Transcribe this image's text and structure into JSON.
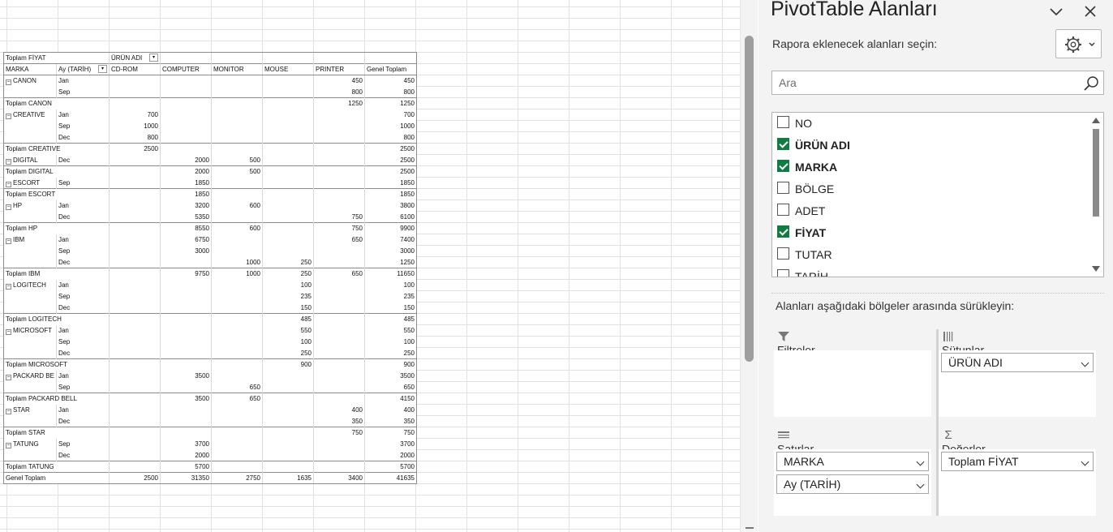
{
  "pivot": {
    "filter_label": "Toplam FİYAT",
    "col_field": "ÜRÜN ADI",
    "headers": [
      "MARKA",
      "Ay (TARİH)",
      "CD-ROM",
      "COMPUTER",
      "MONITOR",
      "MOUSE",
      "PRINTER",
      "Genel Toplam"
    ],
    "rows": [
      {
        "kind": "item",
        "brand": "CANON",
        "month": "Jan",
        "v": [
          "",
          "",
          "",
          "",
          "450",
          "450"
        ]
      },
      {
        "kind": "item",
        "brand": "",
        "month": "Sep",
        "v": [
          "",
          "",
          "",
          "",
          "800",
          "800"
        ]
      },
      {
        "kind": "total",
        "label": "Toplam CANON",
        "v": [
          "",
          "",
          "",
          "",
          "1250",
          "1250"
        ]
      },
      {
        "kind": "item",
        "brand": "CREATIVE",
        "month": "Jan",
        "v": [
          "700",
          "",
          "",
          "",
          "",
          "700"
        ]
      },
      {
        "kind": "item",
        "brand": "",
        "month": "Sep",
        "v": [
          "1000",
          "",
          "",
          "",
          "",
          "1000"
        ]
      },
      {
        "kind": "item",
        "brand": "",
        "month": "Dec",
        "v": [
          "800",
          "",
          "",
          "",
          "",
          "800"
        ]
      },
      {
        "kind": "total",
        "label": "Toplam CREATIVE",
        "v": [
          "2500",
          "",
          "",
          "",
          "",
          "2500"
        ]
      },
      {
        "kind": "item",
        "brand": "DIGITAL",
        "month": "Dec",
        "v": [
          "",
          "2000",
          "500",
          "",
          "",
          "2500"
        ]
      },
      {
        "kind": "total",
        "label": "Toplam DIGITAL",
        "v": [
          "",
          "2000",
          "500",
          "",
          "",
          "2500"
        ]
      },
      {
        "kind": "item",
        "brand": "ESCORT",
        "month": "Sep",
        "v": [
          "",
          "1850",
          "",
          "",
          "",
          "1850"
        ]
      },
      {
        "kind": "total",
        "label": "Toplam ESCORT",
        "v": [
          "",
          "1850",
          "",
          "",
          "",
          "1850"
        ]
      },
      {
        "kind": "item",
        "brand": "HP",
        "month": "Jan",
        "v": [
          "",
          "3200",
          "600",
          "",
          "",
          "3800"
        ]
      },
      {
        "kind": "item",
        "brand": "",
        "month": "Dec",
        "v": [
          "",
          "5350",
          "",
          "",
          "750",
          "6100"
        ]
      },
      {
        "kind": "total",
        "label": "Toplam HP",
        "v": [
          "",
          "8550",
          "600",
          "",
          "750",
          "9900"
        ]
      },
      {
        "kind": "item",
        "brand": "IBM",
        "month": "Jan",
        "v": [
          "",
          "6750",
          "",
          "",
          "650",
          "7400"
        ]
      },
      {
        "kind": "item",
        "brand": "",
        "month": "Sep",
        "v": [
          "",
          "3000",
          "",
          "",
          "",
          "3000"
        ]
      },
      {
        "kind": "item",
        "brand": "",
        "month": "Dec",
        "v": [
          "",
          "",
          "1000",
          "250",
          "",
          "1250"
        ]
      },
      {
        "kind": "total",
        "label": "Toplam IBM",
        "v": [
          "",
          "9750",
          "1000",
          "250",
          "650",
          "11650"
        ]
      },
      {
        "kind": "item",
        "brand": "LOGITECH",
        "month": "Jan",
        "v": [
          "",
          "",
          "",
          "100",
          "",
          "100"
        ]
      },
      {
        "kind": "item",
        "brand": "",
        "month": "Sep",
        "v": [
          "",
          "",
          "",
          "235",
          "",
          "235"
        ]
      },
      {
        "kind": "item",
        "brand": "",
        "month": "Dec",
        "v": [
          "",
          "",
          "",
          "150",
          "",
          "150"
        ]
      },
      {
        "kind": "total",
        "label": "Toplam LOGITECH",
        "v": [
          "",
          "",
          "",
          "485",
          "",
          "485"
        ]
      },
      {
        "kind": "item",
        "brand": "MICROSOFT",
        "month": "Jan",
        "v": [
          "",
          "",
          "",
          "550",
          "",
          "550"
        ]
      },
      {
        "kind": "item",
        "brand": "",
        "month": "Sep",
        "v": [
          "",
          "",
          "",
          "100",
          "",
          "100"
        ]
      },
      {
        "kind": "item",
        "brand": "",
        "month": "Dec",
        "v": [
          "",
          "",
          "",
          "250",
          "",
          "250"
        ]
      },
      {
        "kind": "total",
        "label": "Toplam MICROSOFT",
        "v": [
          "",
          "",
          "",
          "900",
          "",
          "900"
        ]
      },
      {
        "kind": "item",
        "brand": "PACKARD BE",
        "month": "Jan",
        "v": [
          "",
          "3500",
          "",
          "",
          "",
          "3500"
        ]
      },
      {
        "kind": "item",
        "brand": "",
        "month": "Sep",
        "v": [
          "",
          "",
          "650",
          "",
          "",
          "650"
        ]
      },
      {
        "kind": "total",
        "label": "Toplam PACKARD BELL",
        "v": [
          "",
          "3500",
          "650",
          "",
          "",
          "4150"
        ]
      },
      {
        "kind": "item",
        "brand": "STAR",
        "month": "Jan",
        "v": [
          "",
          "",
          "",
          "",
          "400",
          "400"
        ]
      },
      {
        "kind": "item",
        "brand": "",
        "month": "Dec",
        "v": [
          "",
          "",
          "",
          "",
          "350",
          "350"
        ]
      },
      {
        "kind": "total",
        "label": "Toplam STAR",
        "v": [
          "",
          "",
          "",
          "",
          "750",
          "750"
        ]
      },
      {
        "kind": "item",
        "brand": "TATUNG",
        "month": "Sep",
        "v": [
          "",
          "3700",
          "",
          "",
          "",
          "3700"
        ]
      },
      {
        "kind": "item",
        "brand": "",
        "month": "Dec",
        "v": [
          "",
          "2000",
          "",
          "",
          "",
          "2000"
        ]
      },
      {
        "kind": "total",
        "label": "Toplam TATUNG",
        "v": [
          "",
          "5700",
          "",
          "",
          "",
          "5700"
        ]
      },
      {
        "kind": "grand",
        "label": "Genel Toplam",
        "v": [
          "2500",
          "31350",
          "2750",
          "1635",
          "3400",
          "41635"
        ]
      }
    ]
  },
  "panel": {
    "title": "PivotTable Alanları",
    "subheader": "Rapora eklenecek alanları seçin:",
    "search_placeholder": "Ara",
    "fields": [
      {
        "label": "NO",
        "checked": false
      },
      {
        "label": "ÜRÜN ADI",
        "checked": true
      },
      {
        "label": "MARKA",
        "checked": true
      },
      {
        "label": "BÖLGE",
        "checked": false
      },
      {
        "label": "ADET",
        "checked": false
      },
      {
        "label": "FİYAT",
        "checked": true
      },
      {
        "label": "TUTAR",
        "checked": false
      },
      {
        "label": "TARİH",
        "checked": false
      }
    ],
    "drag_hint": "Alanları aşağıdaki bölgeler arasında sürükleyin:",
    "areas": {
      "filters": {
        "label": "Filtreler",
        "items": []
      },
      "columns": {
        "label": "Sütunlar",
        "items": [
          "ÜRÜN ADI"
        ]
      },
      "rows": {
        "label": "Satırlar",
        "items": [
          "MARKA",
          "Ay (TARİH)"
        ]
      },
      "values": {
        "label": "Değerler",
        "items": [
          "Toplam FİYAT"
        ]
      }
    }
  },
  "colors": {
    "checkbox_checked": "#107c41",
    "panel_bg": "#f3f3f3"
  }
}
